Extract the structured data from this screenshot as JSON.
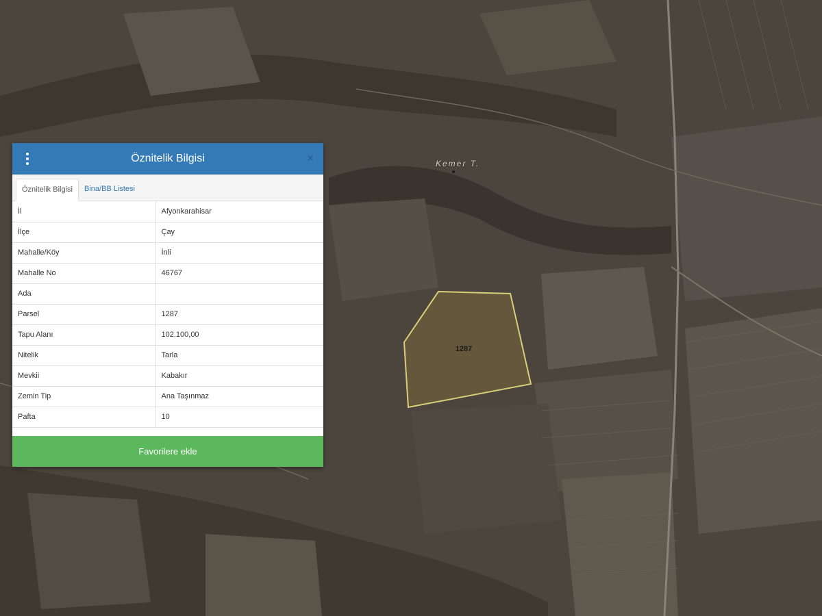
{
  "map": {
    "place_label": "Kemer T.",
    "parcel_label": "1287"
  },
  "panel": {
    "title": "Öznitelik Bilgisi",
    "tabs": [
      {
        "label": "Öznitelik Bilgisi",
        "active": true
      },
      {
        "label": "Bina/BB Listesi",
        "active": false
      }
    ],
    "rows": [
      {
        "key": "İl",
        "value": "Afyonkarahisar"
      },
      {
        "key": "İlçe",
        "value": "Çay"
      },
      {
        "key": "Mahalle/Köy",
        "value": "İnli"
      },
      {
        "key": "Mahalle No",
        "value": "46767"
      },
      {
        "key": "Ada",
        "value": ""
      },
      {
        "key": "Parsel",
        "value": "1287"
      },
      {
        "key": "Tapu Alanı",
        "value": "102.100,00"
      },
      {
        "key": "Nitelik",
        "value": "Tarla"
      },
      {
        "key": "Mevkii",
        "value": "Kabakır"
      },
      {
        "key": "Zemin Tip",
        "value": "Ana Taşınmaz"
      },
      {
        "key": "Pafta",
        "value": "10"
      }
    ],
    "favorite_label": "Favorilere ekle"
  },
  "colors": {
    "header": "#337ab7",
    "favorite_button": "#5cb85c",
    "parcel_outline": "#d8cf7a"
  },
  "icons": {
    "menu": "vertical-dots-icon",
    "close": "close-icon"
  }
}
